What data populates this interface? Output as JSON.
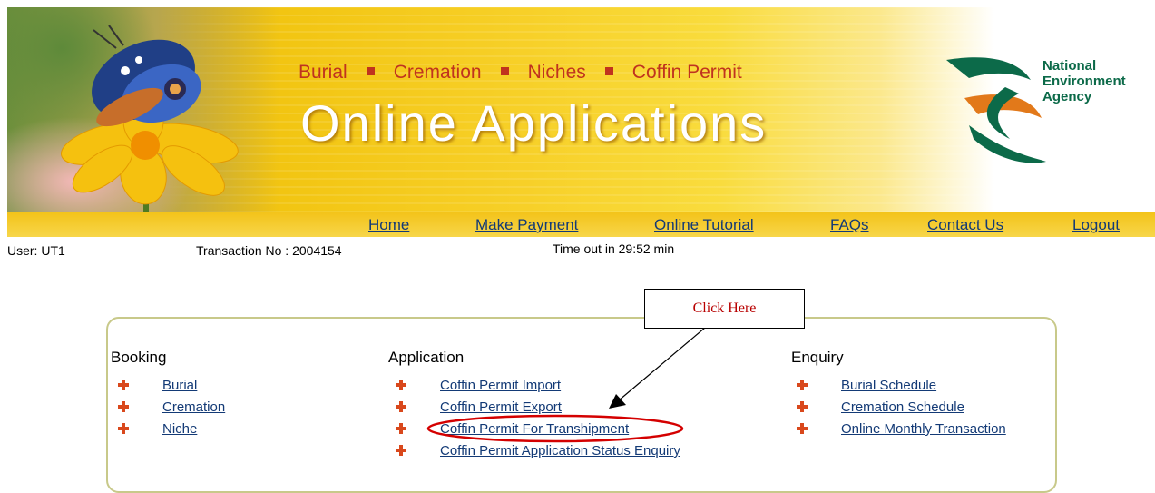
{
  "banner": {
    "sections": [
      "Burial",
      "Cremation",
      "Niches",
      "Coffin Permit"
    ],
    "title": "Online Applications",
    "agency_name_lines": [
      "National",
      "Environment",
      "Agency"
    ],
    "brand_colors": {
      "green": "#0c6a49",
      "orange": "#e2791a",
      "red_text": "#c0331e"
    }
  },
  "nav": {
    "home": "Home",
    "make_payment": "Make Payment",
    "online_tutorial": "Online Tutorial",
    "faqs": "FAQs",
    "contact_us": "Contact Us",
    "logout": "Logout"
  },
  "session": {
    "user": "User: UT1",
    "transaction": "Transaction No : 2004154",
    "timeout": "Time out in 29:52 min"
  },
  "menu": {
    "booking": {
      "heading": "Booking",
      "items": [
        "Burial",
        "Cremation",
        "Niche"
      ]
    },
    "application": {
      "heading": "Application",
      "items": [
        "Coffin Permit Import",
        "Coffin Permit Export",
        "Coffin Permit For Transhipment",
        "Coffin Permit Application Status Enquiry"
      ]
    },
    "enquiry": {
      "heading": "Enquiry",
      "items": [
        "Burial Schedule",
        "Cremation Schedule",
        "Online Monthly Transaction"
      ]
    }
  },
  "annotation": {
    "callout_text": "Click Here",
    "highlighted_item": "Coffin Permit For Transhipment",
    "highlight_color": "#d40000"
  },
  "icons": {
    "bullet": "cross-bullet-icon",
    "logo": "nea-logo-icon",
    "decor": "butterfly-flower-photo"
  }
}
